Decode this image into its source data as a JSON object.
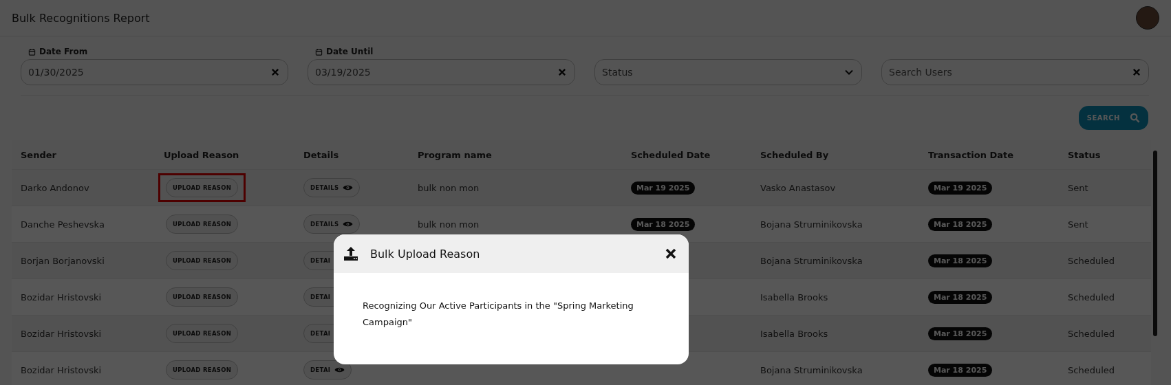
{
  "page": {
    "title": "Bulk Recognitions Report"
  },
  "filters": {
    "date_from": {
      "label": "Date From",
      "value": "01/30/2025"
    },
    "date_until": {
      "label": "Date Until",
      "value": "03/19/2025"
    },
    "status": {
      "placeholder": "Status"
    },
    "search_users": {
      "placeholder": "Search Users"
    }
  },
  "search_button": "SEARCH",
  "table": {
    "columns": [
      "Sender",
      "Upload Reason",
      "Details",
      "Program name",
      "Scheduled Date",
      "Scheduled By",
      "Transaction Date",
      "Status"
    ],
    "rows": [
      {
        "sender": "Darko Andonov",
        "upload_reason": "UPLOAD REASON",
        "highlighted": true,
        "details": "DETAILS",
        "program": "bulk non mon",
        "scheduled_date": "Mar 19 2025",
        "scheduled_by": "Vasko Anastasov",
        "transaction_date": "Mar 19 2025",
        "status": "Sent"
      },
      {
        "sender": "Danche Peshevska",
        "upload_reason": "UPLOAD REASON",
        "highlighted": false,
        "details": "DETAILS",
        "program": "bulk non mon",
        "scheduled_date": "Mar 18 2025",
        "scheduled_by": "Bojana Struminikovska",
        "transaction_date": "Mar 18 2025",
        "status": "Sent"
      },
      {
        "sender": "Borjan Borjanovski",
        "upload_reason": "UPLOAD REASON",
        "highlighted": false,
        "details": "DETAI",
        "scheduled_by": "Bojana Struminikovska",
        "transaction_date": "Mar 18 2025",
        "status": "Scheduled"
      },
      {
        "sender": "Bozidar Hristovski",
        "upload_reason": "UPLOAD REASON",
        "highlighted": false,
        "details": "DETAI",
        "scheduled_by": "Isabella Brooks",
        "transaction_date": "Mar 18 2025",
        "status": "Scheduled"
      },
      {
        "sender": "Bozidar Hristovski",
        "upload_reason": "UPLOAD REASON",
        "highlighted": false,
        "details": "DETAI",
        "scheduled_by": "Isabella Brooks",
        "transaction_date": "Mar 18 2025",
        "status": "Scheduled"
      },
      {
        "sender": "Bozidar Hristovski",
        "upload_reason": "UPLOAD REASON",
        "highlighted": false,
        "details": "DETAI",
        "scheduled_by": "Bojana Struminikovska",
        "transaction_date": "Mar 18 2025",
        "status": "Scheduled"
      }
    ]
  },
  "modal": {
    "title": "Bulk Upload Reason",
    "body": "Recognizing Our Active Participants in the \"Spring Marketing Campaign\""
  }
}
